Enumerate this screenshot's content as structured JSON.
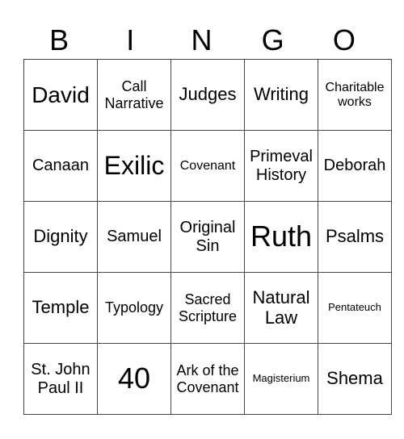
{
  "header": {
    "letters": [
      "B",
      "I",
      "N",
      "G",
      "O"
    ]
  },
  "card": {
    "rows": [
      [
        "David",
        "Call Narrative",
        "Judges",
        "Writing",
        "Charitable works"
      ],
      [
        "Canaan",
        "Exilic",
        "Covenant",
        "Primeval History",
        "Deborah"
      ],
      [
        "Dignity",
        "Samuel",
        "Original Sin",
        "Ruth",
        "Psalms"
      ],
      [
        "Temple",
        "Typology",
        "Sacred Scripture",
        "Natural Law",
        "Pentateuch"
      ],
      [
        "St. John Paul II",
        "40",
        "Ark of the Covenant",
        "Magisterium",
        "Shema"
      ]
    ]
  }
}
